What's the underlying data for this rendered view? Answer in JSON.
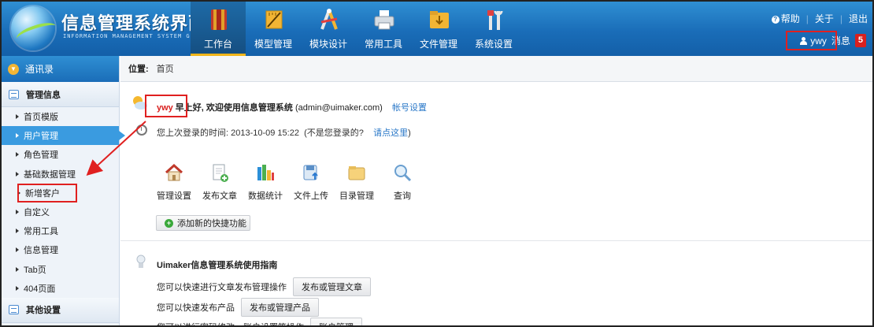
{
  "app": {
    "title": "信息管理系统界面",
    "subtitle": "INFORMATION MANAGEMENT SYSTEM GUI"
  },
  "topnav": [
    {
      "label": "工作台",
      "icon": "book-icon",
      "active": true
    },
    {
      "label": "模型管理",
      "icon": "ruler-icon",
      "active": false
    },
    {
      "label": "模块设计",
      "icon": "compass-icon",
      "active": false
    },
    {
      "label": "常用工具",
      "icon": "printer-icon",
      "active": false
    },
    {
      "label": "文件管理",
      "icon": "folder-icon",
      "active": false
    },
    {
      "label": "系统设置",
      "icon": "tools-icon",
      "active": false
    }
  ],
  "topright": {
    "help": "帮助",
    "about": "关于",
    "logout": "退出",
    "username": "ywy",
    "messages_label": "消息",
    "messages_count": "5"
  },
  "sidebar": {
    "contacts": "通讯录",
    "group1": "管理信息",
    "items": [
      "首页模版",
      "用户管理",
      "角色管理",
      "基础数据管理",
      "新增客户",
      "自定义",
      "常用工具",
      "信息管理",
      "Tab页",
      "404页面"
    ],
    "group2": "其他设置"
  },
  "breadcrumb": {
    "label": "位置:",
    "page": "首页"
  },
  "welcome": {
    "name": "ywy",
    "greeting": "早上好, 欢迎使用信息管理系统",
    "email": "(admin@uimaker.com)",
    "account_link": "帐号设置",
    "last_login_prefix": "您上次登录的时间: 2013-10-09 15:22",
    "last_login_question": "(不是您登录的?",
    "click_here": "请点这里",
    "close_paren": ")"
  },
  "quick": [
    {
      "label": "管理设置",
      "icon": "house-icon"
    },
    {
      "label": "发布文章",
      "icon": "document-add-icon"
    },
    {
      "label": "数据统计",
      "icon": "bar-chart-icon"
    },
    {
      "label": "文件上传",
      "icon": "upload-icon"
    },
    {
      "label": "目录管理",
      "icon": "folder-icon"
    },
    {
      "label": "查询",
      "icon": "magnifier-icon"
    }
  ],
  "add_quick": "添加新的快捷功能",
  "guide": {
    "title": "Uimaker信息管理系统使用指南",
    "rows": [
      {
        "text": "您可以快速进行文章发布管理操作",
        "button": "发布或管理文章"
      },
      {
        "text": "您可以快速发布产品",
        "button": "发布或管理产品"
      },
      {
        "text": "您可以进行密码修改、账户设置等操作",
        "button": "账户管理"
      }
    ]
  },
  "colors": {
    "header_blue": "#1a6db8",
    "active_sidebar": "#3a9be0",
    "highlight_red": "#e02020",
    "link": "#2a78c8"
  }
}
